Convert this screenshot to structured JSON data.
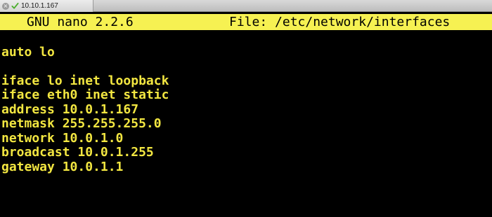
{
  "window": {
    "tab_title": "10.10.1.167",
    "tab_icons": [
      "close-icon",
      "check-icon"
    ]
  },
  "nano": {
    "version": "GNU nano 2.2.6",
    "file_label": "File: /etc/network/interfaces",
    "lines": [
      "",
      "auto lo",
      "",
      "iface lo inet loopback",
      "iface eth0 inet static",
      "address 10.0.1.167",
      "netmask 255.255.255.0",
      "network 10.0.1.0",
      "broadcast 10.0.1.255",
      "gateway 10.0.1.1"
    ]
  },
  "colors": {
    "header_bg": "#f6f152",
    "text": "#f2e641",
    "background": "#000000"
  }
}
